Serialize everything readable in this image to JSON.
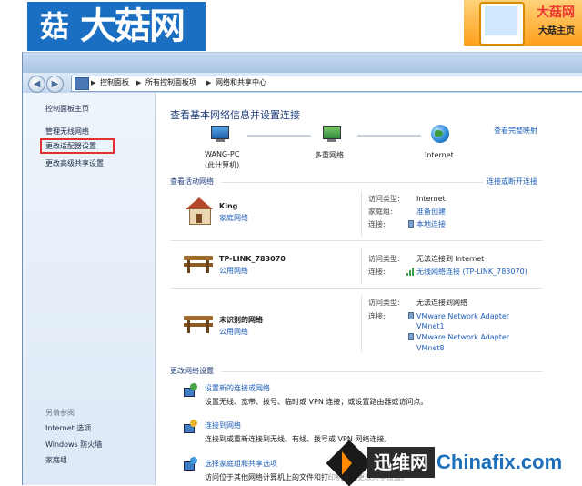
{
  "banner": {
    "logo_icon": "菇",
    "logo_text": "大菇网",
    "ad_title": "大菇网",
    "ad_sub": "大菇主页"
  },
  "breadcrumbs": [
    "控制面板",
    "所有控制面板项",
    "网络和共享中心"
  ],
  "left_pane": {
    "home": "控制面板主页",
    "items": [
      "管理无线网络",
      "更改适配器设置",
      "更改高级共享设置"
    ],
    "see_also_title": "另请参阅",
    "see_also": [
      "Internet 选项",
      "Windows 防火墙",
      "家庭组"
    ]
  },
  "main": {
    "heading": "查看基本网络信息并设置连接",
    "full_map": "查看完整映射",
    "map": {
      "node1_name": "WANG-PC",
      "node1_sub": "(此计算机)",
      "node2_name": "多重网络",
      "node3_name": "Internet"
    },
    "active_title": "查看活动网络",
    "connect_link": "连接或断开连接",
    "networks": [
      {
        "name": "King",
        "type": "家庭网络",
        "access_label": "访问类型:",
        "access_value": "Internet",
        "homegroup_label": "家庭组:",
        "homegroup_value": "准备创建",
        "conn_label": "连接:",
        "conn_value": "本地连接"
      },
      {
        "name": "TP-LINK_783070",
        "type": "公用网络",
        "access_label": "访问类型:",
        "access_value": "无法连接到 Internet",
        "conn_label": "连接:",
        "conn_value": "无线网络连接 (TP-LINK_783070)"
      },
      {
        "name": "未识别的网络",
        "type": "公用网络",
        "access_label": "访问类型:",
        "access_value": "无法连接到网络",
        "conn_label": "连接:",
        "conn_value1a": "VMware Network Adapter",
        "conn_value1b": "VMnet1",
        "conn_value2a": "VMware Network Adapter",
        "conn_value2b": "VMnet8"
      }
    ],
    "change_title": "更改网络设置",
    "tasks": [
      {
        "link": "设置新的连接或网络",
        "desc": "设置无线、宽带、拨号、临时或 VPN 连接；或设置路由器或访问点。"
      },
      {
        "link": "连接到网络",
        "desc": "连接到或重新连接到无线、有线、拨号或 VPN 网络连接。"
      },
      {
        "link": "选择家庭组和共享选项",
        "desc": "访问位于其他网络计算机上的文件和打印机，或更改共享设置。"
      }
    ]
  },
  "watermark": {
    "cn": "迅维网",
    "en": "Chinafix.com"
  }
}
